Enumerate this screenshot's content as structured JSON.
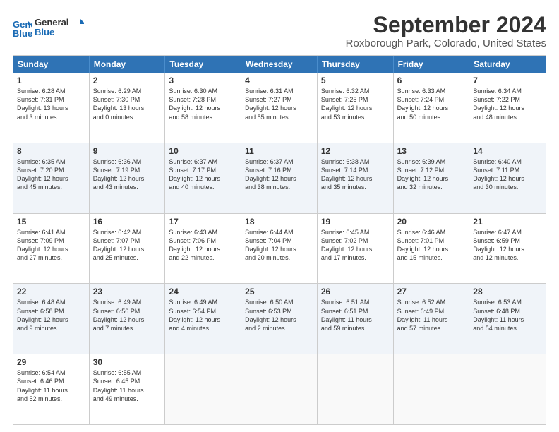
{
  "logo": {
    "line1": "General",
    "line2": "Blue"
  },
  "title": "September 2024",
  "subtitle": "Roxborough Park, Colorado, United States",
  "header_days": [
    "Sunday",
    "Monday",
    "Tuesday",
    "Wednesday",
    "Thursday",
    "Friday",
    "Saturday"
  ],
  "rows": [
    [
      {
        "day": "1",
        "lines": [
          "Sunrise: 6:28 AM",
          "Sunset: 7:31 PM",
          "Daylight: 13 hours",
          "and 3 minutes."
        ]
      },
      {
        "day": "2",
        "lines": [
          "Sunrise: 6:29 AM",
          "Sunset: 7:30 PM",
          "Daylight: 13 hours",
          "and 0 minutes."
        ]
      },
      {
        "day": "3",
        "lines": [
          "Sunrise: 6:30 AM",
          "Sunset: 7:28 PM",
          "Daylight: 12 hours",
          "and 58 minutes."
        ]
      },
      {
        "day": "4",
        "lines": [
          "Sunrise: 6:31 AM",
          "Sunset: 7:27 PM",
          "Daylight: 12 hours",
          "and 55 minutes."
        ]
      },
      {
        "day": "5",
        "lines": [
          "Sunrise: 6:32 AM",
          "Sunset: 7:25 PM",
          "Daylight: 12 hours",
          "and 53 minutes."
        ]
      },
      {
        "day": "6",
        "lines": [
          "Sunrise: 6:33 AM",
          "Sunset: 7:24 PM",
          "Daylight: 12 hours",
          "and 50 minutes."
        ]
      },
      {
        "day": "7",
        "lines": [
          "Sunrise: 6:34 AM",
          "Sunset: 7:22 PM",
          "Daylight: 12 hours",
          "and 48 minutes."
        ]
      }
    ],
    [
      {
        "day": "8",
        "lines": [
          "Sunrise: 6:35 AM",
          "Sunset: 7:20 PM",
          "Daylight: 12 hours",
          "and 45 minutes."
        ]
      },
      {
        "day": "9",
        "lines": [
          "Sunrise: 6:36 AM",
          "Sunset: 7:19 PM",
          "Daylight: 12 hours",
          "and 43 minutes."
        ]
      },
      {
        "day": "10",
        "lines": [
          "Sunrise: 6:37 AM",
          "Sunset: 7:17 PM",
          "Daylight: 12 hours",
          "and 40 minutes."
        ]
      },
      {
        "day": "11",
        "lines": [
          "Sunrise: 6:37 AM",
          "Sunset: 7:16 PM",
          "Daylight: 12 hours",
          "and 38 minutes."
        ]
      },
      {
        "day": "12",
        "lines": [
          "Sunrise: 6:38 AM",
          "Sunset: 7:14 PM",
          "Daylight: 12 hours",
          "and 35 minutes."
        ]
      },
      {
        "day": "13",
        "lines": [
          "Sunrise: 6:39 AM",
          "Sunset: 7:12 PM",
          "Daylight: 12 hours",
          "and 32 minutes."
        ]
      },
      {
        "day": "14",
        "lines": [
          "Sunrise: 6:40 AM",
          "Sunset: 7:11 PM",
          "Daylight: 12 hours",
          "and 30 minutes."
        ]
      }
    ],
    [
      {
        "day": "15",
        "lines": [
          "Sunrise: 6:41 AM",
          "Sunset: 7:09 PM",
          "Daylight: 12 hours",
          "and 27 minutes."
        ]
      },
      {
        "day": "16",
        "lines": [
          "Sunrise: 6:42 AM",
          "Sunset: 7:07 PM",
          "Daylight: 12 hours",
          "and 25 minutes."
        ]
      },
      {
        "day": "17",
        "lines": [
          "Sunrise: 6:43 AM",
          "Sunset: 7:06 PM",
          "Daylight: 12 hours",
          "and 22 minutes."
        ]
      },
      {
        "day": "18",
        "lines": [
          "Sunrise: 6:44 AM",
          "Sunset: 7:04 PM",
          "Daylight: 12 hours",
          "and 20 minutes."
        ]
      },
      {
        "day": "19",
        "lines": [
          "Sunrise: 6:45 AM",
          "Sunset: 7:02 PM",
          "Daylight: 12 hours",
          "and 17 minutes."
        ]
      },
      {
        "day": "20",
        "lines": [
          "Sunrise: 6:46 AM",
          "Sunset: 7:01 PM",
          "Daylight: 12 hours",
          "and 15 minutes."
        ]
      },
      {
        "day": "21",
        "lines": [
          "Sunrise: 6:47 AM",
          "Sunset: 6:59 PM",
          "Daylight: 12 hours",
          "and 12 minutes."
        ]
      }
    ],
    [
      {
        "day": "22",
        "lines": [
          "Sunrise: 6:48 AM",
          "Sunset: 6:58 PM",
          "Daylight: 12 hours",
          "and 9 minutes."
        ]
      },
      {
        "day": "23",
        "lines": [
          "Sunrise: 6:49 AM",
          "Sunset: 6:56 PM",
          "Daylight: 12 hours",
          "and 7 minutes."
        ]
      },
      {
        "day": "24",
        "lines": [
          "Sunrise: 6:49 AM",
          "Sunset: 6:54 PM",
          "Daylight: 12 hours",
          "and 4 minutes."
        ]
      },
      {
        "day": "25",
        "lines": [
          "Sunrise: 6:50 AM",
          "Sunset: 6:53 PM",
          "Daylight: 12 hours",
          "and 2 minutes."
        ]
      },
      {
        "day": "26",
        "lines": [
          "Sunrise: 6:51 AM",
          "Sunset: 6:51 PM",
          "Daylight: 11 hours",
          "and 59 minutes."
        ]
      },
      {
        "day": "27",
        "lines": [
          "Sunrise: 6:52 AM",
          "Sunset: 6:49 PM",
          "Daylight: 11 hours",
          "and 57 minutes."
        ]
      },
      {
        "day": "28",
        "lines": [
          "Sunrise: 6:53 AM",
          "Sunset: 6:48 PM",
          "Daylight: 11 hours",
          "and 54 minutes."
        ]
      }
    ],
    [
      {
        "day": "29",
        "lines": [
          "Sunrise: 6:54 AM",
          "Sunset: 6:46 PM",
          "Daylight: 11 hours",
          "and 52 minutes."
        ]
      },
      {
        "day": "30",
        "lines": [
          "Sunrise: 6:55 AM",
          "Sunset: 6:45 PM",
          "Daylight: 11 hours",
          "and 49 minutes."
        ]
      },
      {
        "day": "",
        "lines": []
      },
      {
        "day": "",
        "lines": []
      },
      {
        "day": "",
        "lines": []
      },
      {
        "day": "",
        "lines": []
      },
      {
        "day": "",
        "lines": []
      }
    ]
  ],
  "alt_rows": [
    1,
    3
  ]
}
